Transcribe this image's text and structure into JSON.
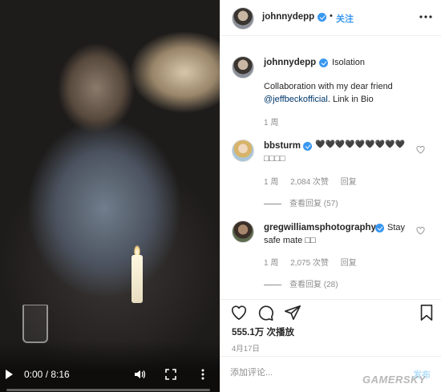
{
  "video": {
    "current_time": "0:00",
    "duration": "8:16",
    "time_display": "0:00 / 8:16",
    "progress": 0.0,
    "icons": [
      "play-icon",
      "volume-icon",
      "fullscreen-icon",
      "more-vertical-icon"
    ]
  },
  "header": {
    "username": "johnnydepp",
    "dot": "•",
    "follow_label": "关注"
  },
  "caption": {
    "username": "johnnydepp",
    "title": "Isolation",
    "line1": "Collaboration with my dear friend",
    "mention": "@jeffbeckofficial",
    "line2_rest": ". Link in Bio",
    "time": "1 周"
  },
  "comments": [
    {
      "username": "bbsturm",
      "text_line1": "🖤🖤🖤🖤🖤🖤🖤🖤🖤",
      "text_line2": "□□□□",
      "time": "1 周",
      "likes": "2,084 次赞",
      "reply_label": "回复",
      "view_replies": "查看回复 (57)"
    },
    {
      "username": "gregwilliamsphotography",
      "text_line1": "Stay",
      "text_line2": "safe mate □□",
      "time": "1 周",
      "likes": "2,075 次赞",
      "reply_label": "回复",
      "view_replies": "查看回复 (28)"
    }
  ],
  "actions": {
    "views": "555.1万 次播放",
    "date": "4月17日"
  },
  "comment_box": {
    "placeholder": "添加评论...",
    "post_label": "发布"
  },
  "watermark": "GAMERSKY",
  "colors": {
    "accent": "#3897f0",
    "text": "#262626",
    "muted": "#8e8e8e",
    "mention": "#00376b"
  }
}
